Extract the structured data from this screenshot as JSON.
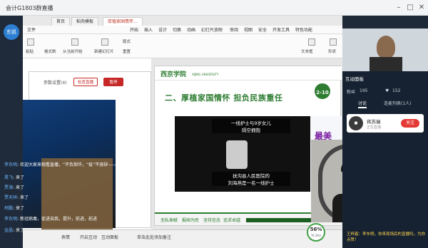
{
  "window": {
    "title": "会计G1803群直播"
  },
  "left_strip": {
    "avatar_label": "东凯"
  },
  "ppt": {
    "tabs": [
      "首页",
      "稻壳模板",
      "厚植家国情怀…"
    ],
    "active_tab": 2,
    "menu_items": [
      "文件",
      "开始",
      "插入",
      "设计",
      "切换",
      "动画",
      "幻灯片放映",
      "审阅",
      "视图",
      "安全",
      "开发工具",
      "特色功能"
    ],
    "ribbon": {
      "paste": "粘贴",
      "format_painter": "格式刷",
      "from_current": "从当前开始",
      "new_slide": "新建幻灯片",
      "layout": "版式",
      "reset": "重置",
      "textbox": "文本框",
      "shape": "形状"
    }
  },
  "inner_window": {
    "label": "参数设置(4)",
    "btn_check": "检查直播",
    "btn_pause": "暂停"
  },
  "chat": [
    {
      "name": "李东明",
      "text": "欢迎大家来观看直播，“不负韶华，“疫”不容辞——大学生的担当”"
    },
    {
      "name": "昊飞",
      "text": "来了"
    },
    {
      "name": "贾涛",
      "text": "来了"
    },
    {
      "name": "贾天祥",
      "text": "来了"
    },
    {
      "name": "柯鹏",
      "text": "来了"
    },
    {
      "name": "李东明",
      "text": "新冠病毒，促进自我，提升，前进，前进"
    },
    {
      "name": "金晶",
      "text": "来了"
    }
  ],
  "slide": {
    "logo_text": "西京学院",
    "logo_sub": "XIJING UNIVERSITY",
    "badge": "2-10",
    "title": "二、厚植家国情怀  担负民族重任",
    "caption_top": "一线护士与9岁女儿\n隔空拥抱",
    "caption_bottom": "扶沟县人民医院的\n刘海燕是一名一线护士",
    "side_text": "最美的平凡",
    "footer_items": [
      "无私奉献",
      "报国为民",
      "坚持信念",
      "追求卓越"
    ]
  },
  "status_bar": {
    "items": [
      "表情",
      "开启互动",
      "互动面板",
      "添加"
    ],
    "placeholder": "单击此处添加备注",
    "gauge_value": "56%",
    "gauge_sub": "76.2K/s"
  },
  "right_panel": {
    "title": "互动面板",
    "viewers_label": "粉丝",
    "viewers": "195",
    "likes": "152",
    "tab_chat": "讨论",
    "tab_viewers": "连麦列表(1人)",
    "host_name": "蒋苏瑞",
    "host_status": "正在直播",
    "follow_label": "关注",
    "bottom_msg": "王梓鑫：李东明，你来现场后的直播吗，为你点赞！"
  }
}
